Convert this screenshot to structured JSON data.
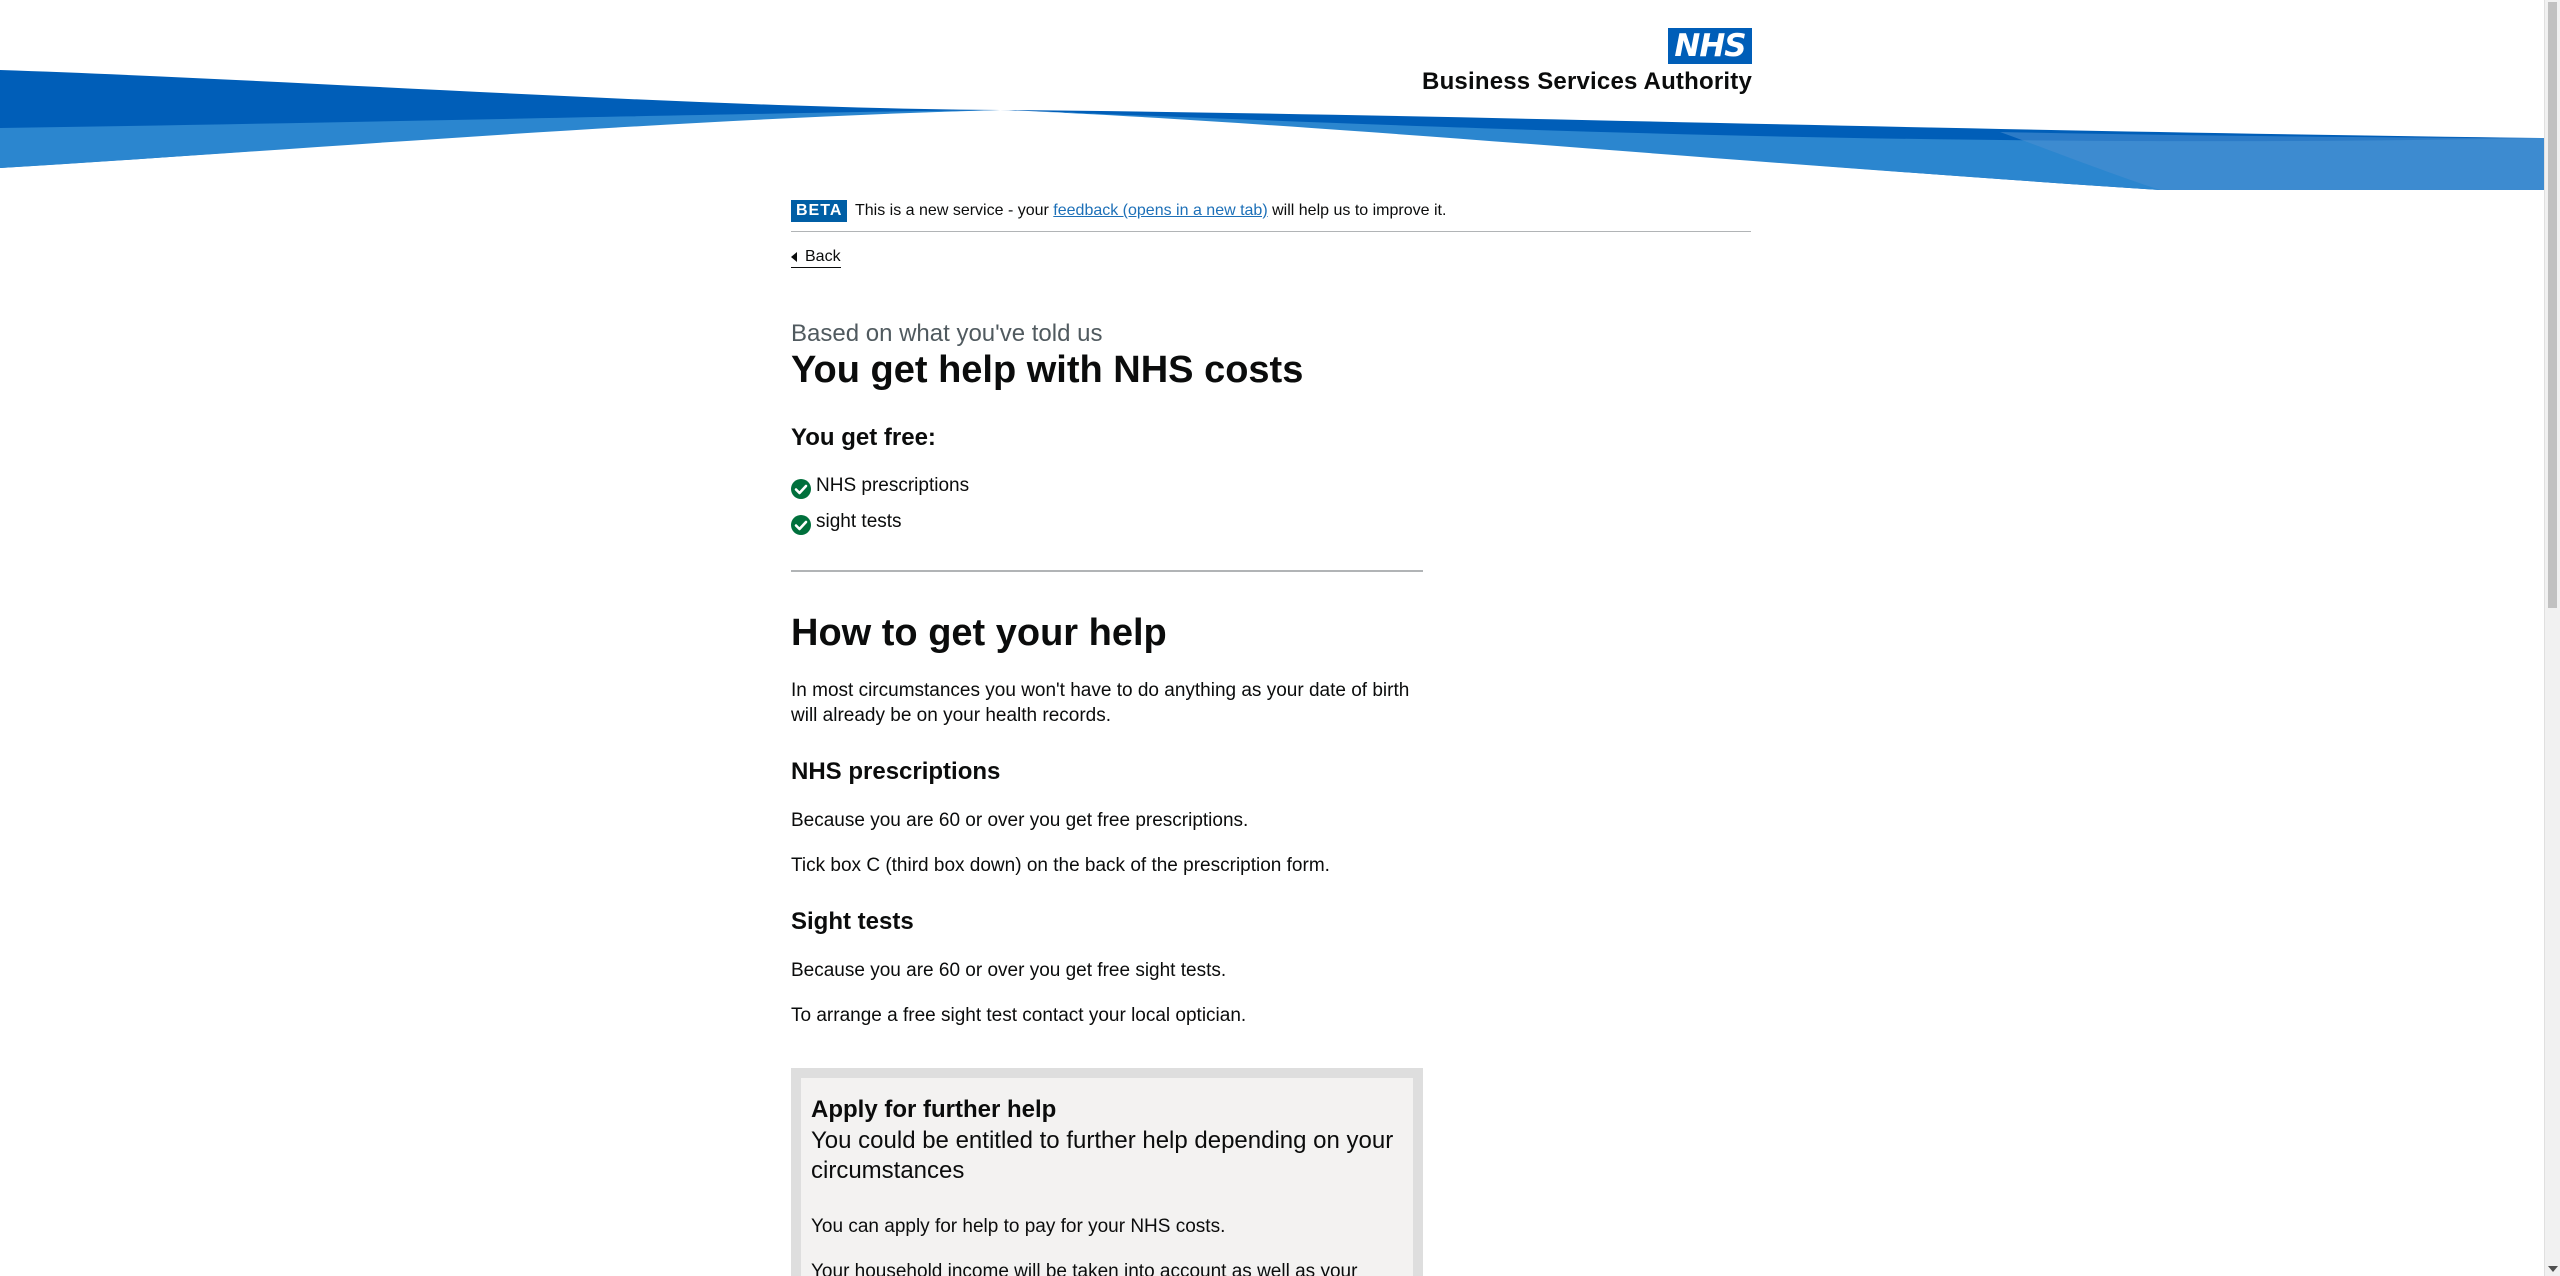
{
  "header": {
    "logo_nhs": "NHS",
    "logo_org": "Business Services Authority",
    "colors": {
      "swoosh_dark": "#005eb8",
      "swoosh_light": "#41b6e6",
      "nhs_blue": "#005eb8"
    }
  },
  "phase_banner": {
    "tag": "BETA",
    "text_before": "This is a new service - your",
    "link": "feedback (opens in a new tab)",
    "text_after": "will help us to improve it."
  },
  "back_link": "Back",
  "result": {
    "caption": "Based on what you've told us",
    "title": "You get help with NHS costs",
    "free_heading": "You get free:",
    "free_items": [
      {
        "label": "NHS prescriptions",
        "icon": "check-circle-icon"
      },
      {
        "label": "sight tests",
        "icon": "check-circle-icon"
      }
    ]
  },
  "how_to": {
    "heading": "How to get your help",
    "intro": "In most circumstances you won't have to do anything as your date of birth will already be on your health records.",
    "sections": [
      {
        "heading": "NHS prescriptions",
        "paragraphs": [
          "Because you are 60 or over you get free prescriptions.",
          "Tick box C (third box down) on the back of the prescription form."
        ]
      },
      {
        "heading": "Sight tests",
        "paragraphs": [
          "Because you are 60 or over you get free sight tests.",
          "To arrange a free sight test contact your local optician."
        ]
      }
    ]
  },
  "further_help": {
    "heading": "Apply for further help",
    "subheading": "You could be entitled to further help depending on your circumstances",
    "paragraphs": [
      "You can apply for help to pay for your NHS costs.",
      "Your household income will be taken into account as well as your"
    ]
  }
}
